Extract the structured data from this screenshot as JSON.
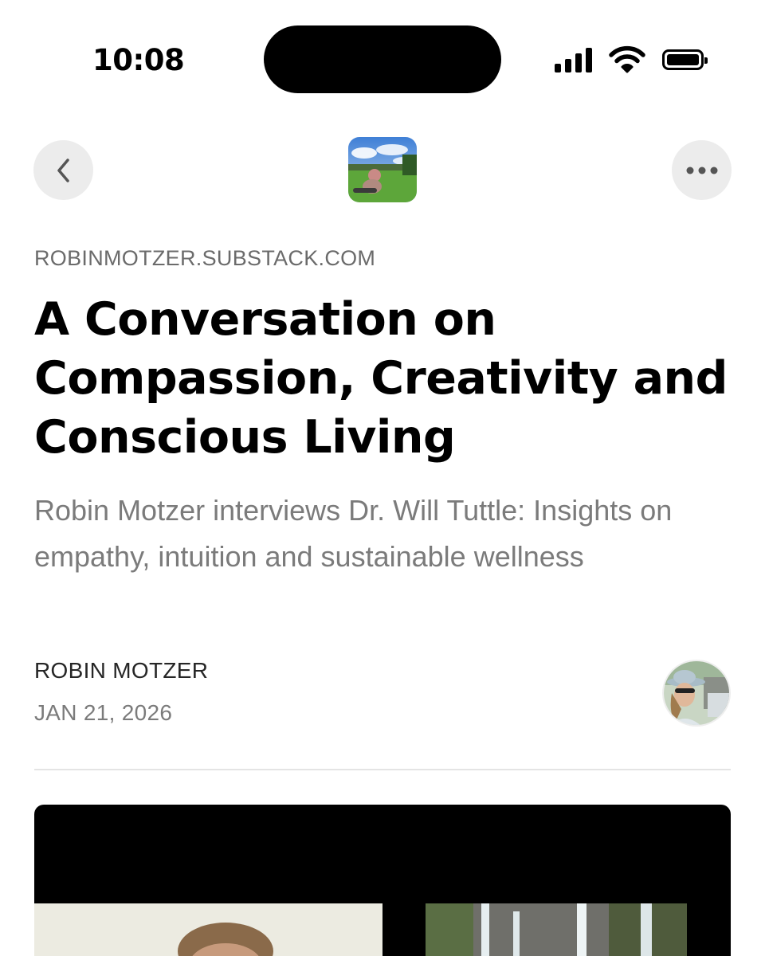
{
  "status_bar": {
    "time": "10:08"
  },
  "nav": {
    "back_icon": "chevron-left-icon",
    "more_icon": "ellipsis-icon"
  },
  "article": {
    "publication": "ROBINMOTZER.SUBSTACK.COM",
    "title": "A Conversation on Compassion, Creativity and Conscious Living",
    "subtitle": "Robin Motzer interviews Dr. Will Tuttle: Insights on empathy, intuition and sustainable wellness",
    "author": "ROBIN MOTZER",
    "date": "JAN 21, 2026"
  },
  "colors": {
    "accent_gray": "#ececec",
    "subtitle_gray": "#7b7b7b",
    "divider": "#e4e4e4"
  }
}
